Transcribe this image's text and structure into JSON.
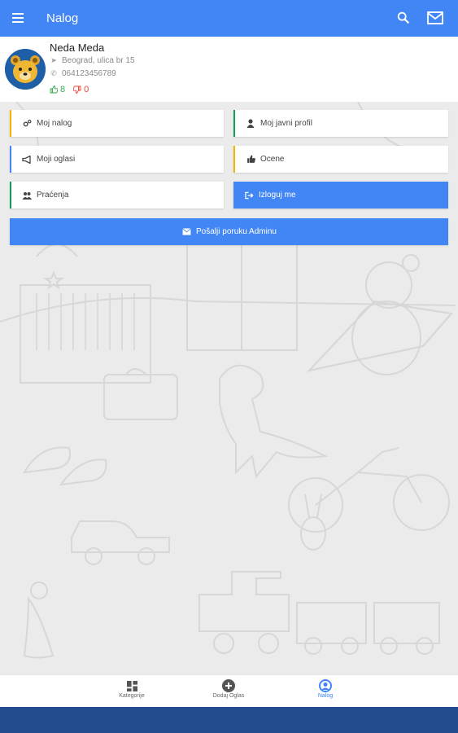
{
  "app": {
    "title": "Nalog"
  },
  "profile": {
    "name": "Neda Meda",
    "address": "Beograd, ulica br 15",
    "phone": "064123456789",
    "likes": "8",
    "dislikes": "0"
  },
  "actions": {
    "my_account": "Moj nalog",
    "public_profile": "Moj javni profil",
    "my_ads": "Moji oglasi",
    "ratings": "Ocene",
    "following": "Praćenja",
    "logout": "Izloguj me",
    "message_admin": "Pošalji poruku Adminu"
  },
  "bottom_nav": {
    "categories": "Kategorije",
    "add_ad": "Dodaj Oglas",
    "account": "Nalog"
  },
  "colors": {
    "primary": "#4285f4",
    "accent_yellow": "#f4b400",
    "accent_green": "#0f9d58",
    "accent_blue": "#4285f4",
    "system_bar": "#234c8f"
  }
}
